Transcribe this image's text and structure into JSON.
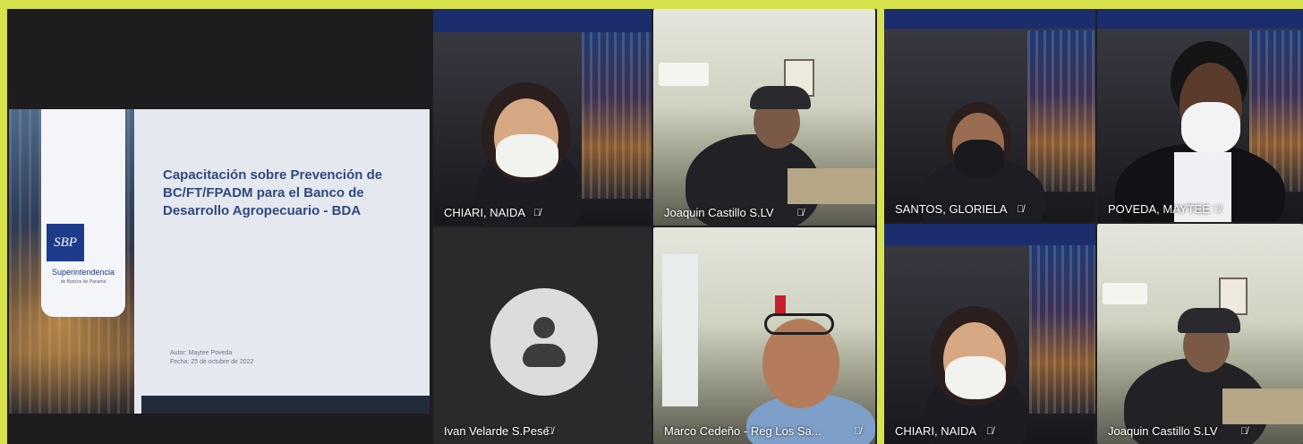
{
  "slide": {
    "title": "Capacitación sobre Prevención de BC/FT/FPADM para el Banco de Desarrollo Agropecuario - BDA",
    "author": "Autor: Maytee Poveda",
    "date": "Fecha: 25 de octubre de 2022",
    "logo_mark": "SBP",
    "logo_name": "Superintendencia",
    "logo_sub": "de Bancos de Panamá"
  },
  "participants_left": [
    {
      "name": "CHIARI, NAIDA"
    },
    {
      "name": "Joaquin Castillo S.LV"
    },
    {
      "name": "Ivan Velarde S.Pesé"
    },
    {
      "name": "Marco Cedeño - Reg Los Sa..."
    }
  ],
  "participants_right": [
    {
      "name": "SANTOS, GLORIELA"
    },
    {
      "name": "POVEDA, MAYTEE"
    },
    {
      "name": "CHIARI, NAIDA"
    },
    {
      "name": "Joaquin Castillo S.LV"
    }
  ],
  "mic_muted_glyph": "🎙̸",
  "icons": {
    "mic": "mic-off-icon",
    "avatar": "user-avatar-icon"
  }
}
